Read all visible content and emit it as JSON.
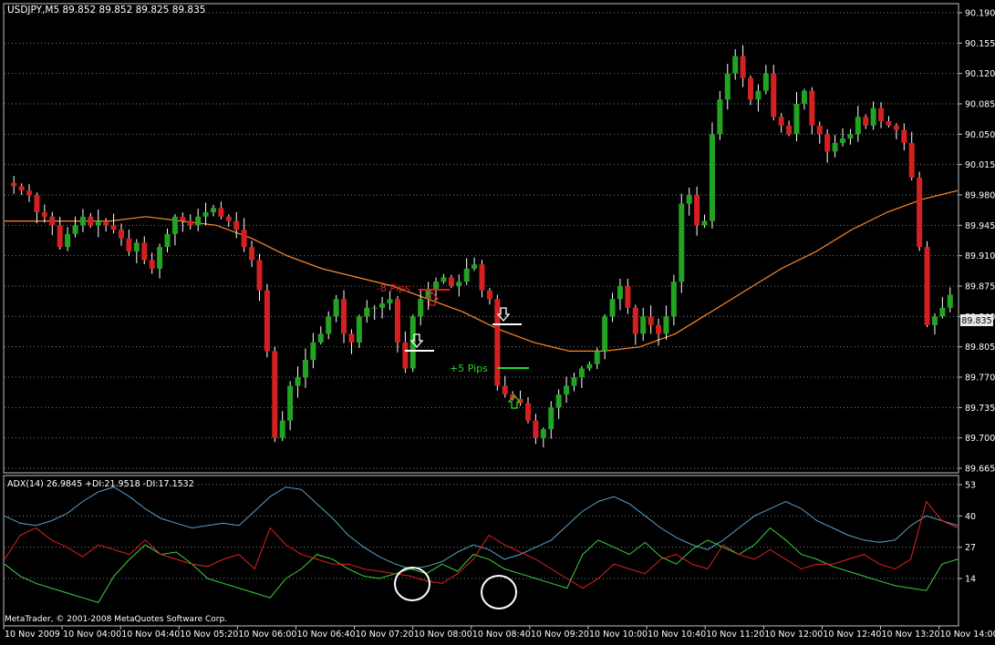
{
  "colors": {
    "background": "#000000",
    "grid": "#7f7f7f",
    "frame": "#c0c0c0",
    "axis_text": "#ffffff",
    "bull_candle": "#22a322",
    "bear_candle": "#d42020",
    "wick": "#ffffff",
    "ma": "#ff8a2a",
    "adx": "#5aa0c8",
    "plus_di": "#3cd23c",
    "minus_di": "#e02020",
    "price_box_bg": "#e8e8e8",
    "price_box_text": "#000000",
    "loss_text": "#e02020",
    "win_text": "#2ad42a",
    "marker": "#ffffff"
  },
  "main_header": {
    "text": "USDJPY,M5  89.852 89.852 89.825 89.835"
  },
  "adx_header": {
    "text": "ADX(14) 26.9845 +DI:21.9518 -DI:17.1532"
  },
  "copyright": "MetaTrader, © 2001-2008 MetaQuotes Software Corp.",
  "current_price": "89.835",
  "annotations": {
    "loss_label": "-8 Pips",
    "win_label": "+5 Pips"
  },
  "chart_data": [
    {
      "type": "candlestick",
      "symbol": "USDJPY",
      "timeframe": "M5",
      "title": "USDJPY,M5  89.852 89.852 89.825 89.835",
      "ylim": [
        89.665,
        90.19
      ],
      "y_tick_labels": [
        "90.190",
        "90.155",
        "90.120",
        "90.085",
        "90.050",
        "90.015",
        "89.980",
        "89.945",
        "89.910",
        "89.875",
        "89.840",
        "89.805",
        "89.770",
        "89.735",
        "89.700",
        "89.665"
      ],
      "x_tick_labels": [
        "10 Nov 2009",
        "10 Nov 04:00",
        "10 Nov 04:40",
        "10 Nov 05:20",
        "10 Nov 06:00",
        "10 Nov 06:40",
        "10 Nov 07:20",
        "10 Nov 08:00",
        "10 Nov 08:40",
        "10 Nov 09:20",
        "10 Nov 10:00",
        "10 Nov 10:40",
        "10 Nov 11:20",
        "10 Nov 12:00",
        "10 Nov 12:40",
        "10 Nov 13:20",
        "10 Nov 14:00"
      ],
      "close_path": [
        89.99,
        89.985,
        89.98,
        89.96,
        89.955,
        89.945,
        89.92,
        89.935,
        89.945,
        89.955,
        89.945,
        89.95,
        89.945,
        89.94,
        89.93,
        89.915,
        89.925,
        89.905,
        89.895,
        89.92,
        89.935,
        89.955,
        89.95,
        89.945,
        89.955,
        89.96,
        89.965,
        89.955,
        89.95,
        89.94,
        89.92,
        89.905,
        89.87,
        89.8,
        89.7,
        89.72,
        89.76,
        89.77,
        89.79,
        89.81,
        89.82,
        89.84,
        89.86,
        89.82,
        89.81,
        89.84,
        89.85,
        89.85,
        89.855,
        89.86,
        89.81,
        89.78,
        89.84,
        89.86,
        89.87,
        89.88,
        89.885,
        89.875,
        89.88,
        89.895,
        89.9,
        89.87,
        89.86,
        89.76,
        89.75,
        89.745,
        89.74,
        89.72,
        89.7,
        89.71,
        89.735,
        89.75,
        89.76,
        89.77,
        89.78,
        89.785,
        89.8,
        89.84,
        89.86,
        89.875,
        89.85,
        89.82,
        89.84,
        89.83,
        89.82,
        89.84,
        89.88,
        89.97,
        89.98,
        89.945,
        89.95,
        90.05,
        90.09,
        90.12,
        90.14,
        90.115,
        90.09,
        90.1,
        90.12,
        90.07,
        90.06,
        90.05,
        90.085,
        90.1,
        90.06,
        90.05,
        90.03,
        90.04,
        90.045,
        90.05,
        90.07,
        90.06,
        90.08,
        90.065,
        90.06,
        90.055,
        90.04,
        90.0,
        89.92,
        89.83,
        89.84,
        89.85,
        89.865
      ],
      "moving_average": [
        89.95,
        89.95,
        89.95,
        89.95,
        89.955,
        89.95,
        89.945,
        89.93,
        89.91,
        89.895,
        89.885,
        89.875,
        89.86,
        89.845,
        89.825,
        89.81,
        89.8,
        89.8,
        89.805,
        89.82,
        89.845,
        89.87,
        89.895,
        89.915,
        89.94,
        89.96,
        89.975,
        89.985
      ],
      "annotations": [
        {
          "text": "-8 Pips",
          "kind": "loss"
        },
        {
          "text": "+5 Pips",
          "kind": "win"
        }
      ],
      "current_price": 89.835
    },
    {
      "type": "line",
      "title": "ADX(14) 26.9845 +DI:21.9518 -DI:17.1532",
      "ylim": [
        0,
        53
      ],
      "y_tick_labels": [
        "53",
        "40",
        "27",
        "14"
      ],
      "series": [
        {
          "name": "ADX(14)",
          "value": 26.9845,
          "color": "#5aa0c8",
          "values": [
            40,
            37,
            36,
            38,
            41,
            46,
            50,
            52,
            48,
            43,
            39,
            37,
            35,
            36,
            37,
            36,
            42,
            48,
            52,
            51,
            45,
            39,
            32,
            27,
            23,
            20,
            18,
            19,
            21,
            25,
            28,
            26,
            22,
            24,
            27,
            30,
            36,
            42,
            46,
            48,
            45,
            40,
            35,
            31,
            28,
            26,
            30,
            35,
            40,
            43,
            46,
            43,
            38,
            35,
            32,
            30,
            29,
            30,
            36,
            40,
            38,
            36
          ]
        },
        {
          "name": "+DI",
          "value": 21.9518,
          "color": "#3cd23c",
          "values": [
            20,
            15,
            12,
            10,
            8,
            6,
            4,
            15,
            22,
            28,
            24,
            25,
            20,
            14,
            12,
            10,
            8,
            6,
            14,
            18,
            24,
            22,
            18,
            15,
            14,
            16,
            18,
            16,
            20,
            17,
            24,
            22,
            18,
            16,
            14,
            12,
            10,
            24,
            30,
            27,
            24,
            29,
            23,
            20,
            26,
            30,
            27,
            24,
            28,
            35,
            30,
            24,
            22,
            19,
            17,
            15,
            13,
            11,
            10,
            9,
            20,
            22
          ]
        },
        {
          "name": "-DI",
          "value": 17.1532,
          "color": "#e02020",
          "values": [
            22,
            32,
            35,
            30,
            27,
            23,
            28,
            26,
            24,
            30,
            24,
            22,
            20,
            19,
            22,
            24,
            18,
            35,
            28,
            24,
            22,
            20,
            20,
            18,
            17,
            16,
            15,
            13,
            12,
            16,
            22,
            32,
            28,
            25,
            22,
            18,
            14,
            10,
            14,
            20,
            18,
            16,
            22,
            24,
            20,
            18,
            28,
            24,
            22,
            26,
            22,
            18,
            20,
            20,
            22,
            24,
            20,
            18,
            22,
            46,
            38,
            35
          ]
        }
      ]
    }
  ]
}
